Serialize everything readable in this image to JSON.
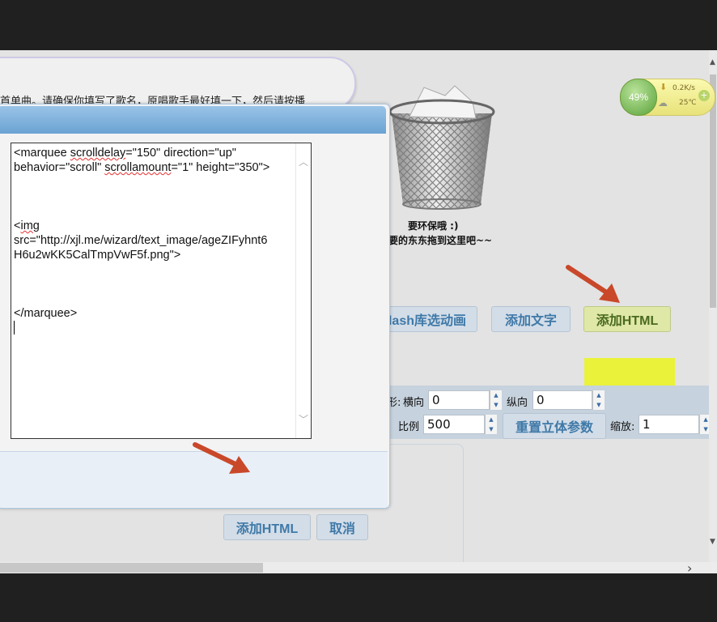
{
  "page": {
    "intro_text": "首单曲。请确保你填写了歌名，原唱歌手最好填一下，然后请按播",
    "trash_line1": "要环保哦 :)",
    "trash_line2": "要的东东拖到这里吧~~"
  },
  "toolbar": {
    "flash_library": "lash库选动画",
    "add_text": "添加文字",
    "add_html": "添加HTML"
  },
  "transform": {
    "label_partial": "形:",
    "horizontal_label": "横向",
    "horizontal_value": "0",
    "vertical_label": "纵向",
    "vertical_value": "0",
    "ratio_label": "比例",
    "ratio_value": "500",
    "reset_3d": "重置立体参数",
    "zoom_label": "缩放:",
    "zoom_value": "1"
  },
  "dialog": {
    "editor_lines": [
      {
        "text": "<marquee scrolldelay=\"150\" direction=\"up\""
      },
      {
        "text": "behavior=\"scroll\" scrollamount=\"1\" height=\"350\">"
      },
      {
        "text": ""
      },
      {
        "text": ""
      },
      {
        "text": ""
      },
      {
        "text": "<img"
      },
      {
        "text": "src=\"http://xjl.me/wizard/text_image/ageZIFyhnt6"
      },
      {
        "text": "H6u2wKK5CalTmpVwF5f.png\">"
      },
      {
        "text": ""
      },
      {
        "text": ""
      },
      {
        "text": ""
      },
      {
        "text": "</marquee>"
      }
    ],
    "confirm_button": "添加HTML",
    "cancel_button": "取消"
  },
  "weather_widget": {
    "percent": "49%",
    "speed": "0.2K/s",
    "temperature": "25℃"
  },
  "colors": {
    "button_text": "#3f79a8",
    "highlight": "#eaf23a",
    "annotation_arrow": "#c9482a"
  }
}
